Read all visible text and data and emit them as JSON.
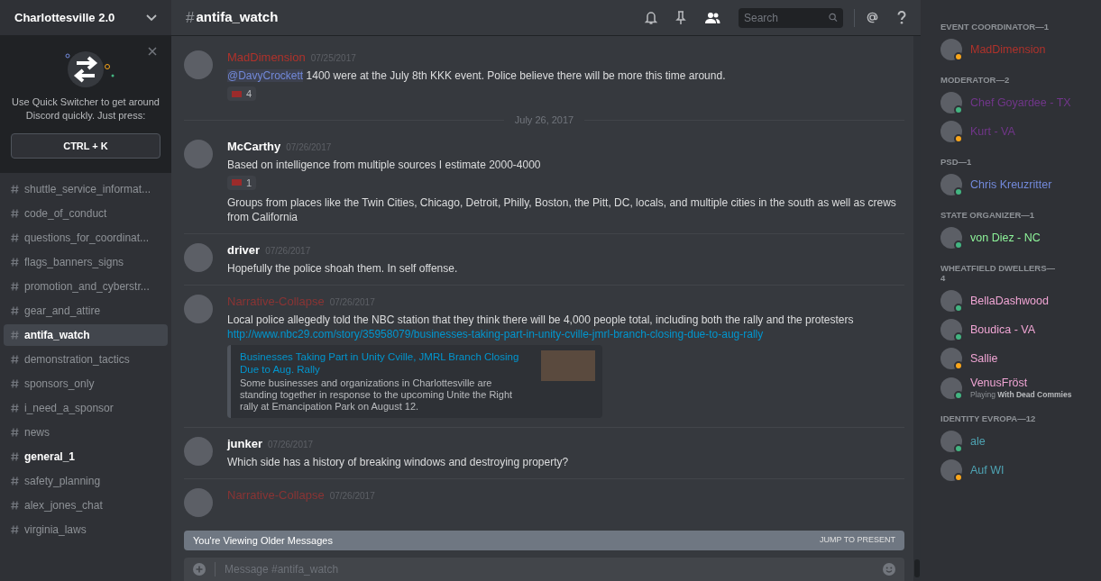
{
  "server": {
    "name": "Charlottesville 2.0"
  },
  "quick_switcher": {
    "text": "Use Quick Switcher to get around Discord quickly. Just press:",
    "shortcut": "CTRL + K"
  },
  "channels": [
    {
      "name": "shuttle_service_informat...",
      "selected": false,
      "unread": false
    },
    {
      "name": "code_of_conduct",
      "selected": false,
      "unread": false
    },
    {
      "name": "questions_for_coordinat...",
      "selected": false,
      "unread": false
    },
    {
      "name": "flags_banners_signs",
      "selected": false,
      "unread": false
    },
    {
      "name": "promotion_and_cyberstr...",
      "selected": false,
      "unread": false
    },
    {
      "name": "gear_and_attire",
      "selected": false,
      "unread": false
    },
    {
      "name": "antifa_watch",
      "selected": true,
      "unread": true
    },
    {
      "name": "demonstration_tactics",
      "selected": false,
      "unread": false
    },
    {
      "name": "sponsors_only",
      "selected": false,
      "unread": false
    },
    {
      "name": "i_need_a_sponsor",
      "selected": false,
      "unread": false
    },
    {
      "name": "news",
      "selected": false,
      "unread": false
    },
    {
      "name": "general_1",
      "selected": false,
      "unread": true
    },
    {
      "name": "safety_planning",
      "selected": false,
      "unread": false
    },
    {
      "name": "alex_jones_chat",
      "selected": false,
      "unread": false
    },
    {
      "name": "virginia_laws",
      "selected": false,
      "unread": false
    }
  ],
  "header": {
    "hash": "#",
    "channel": "antifa_watch",
    "search_placeholder": "Search"
  },
  "messages": [
    {
      "kind": "message",
      "author": "MadDimension",
      "color": "#b0322b",
      "time": "07/25/2017",
      "lines": [
        {
          "mention": "@DavyCrockett",
          "text": "1400 were at the July 8th KKK event. Police believe there will be more this time around."
        }
      ],
      "reactions": [
        {
          "count": "4"
        }
      ]
    },
    {
      "kind": "divider",
      "label": "July 26, 2017"
    },
    {
      "kind": "message",
      "author": "McCarthy",
      "color": "#ffffff",
      "time": "07/26/2017",
      "lines": [
        {
          "text": "Based on intelligence from multiple sources I estimate 2000-4000"
        }
      ],
      "reactions": [
        {
          "count": "1"
        }
      ],
      "extra": "Groups from places like the Twin Cities, Chicago, Detroit, Philly, Boston, the Pitt, DC, locals, and multiple cities in the south as well as crews from California"
    },
    {
      "kind": "message",
      "author": "driver",
      "color": "#ffffff",
      "time": "07/26/2017",
      "lines": [
        {
          "text": "Hopefully the police shoah them. In self offense."
        }
      ]
    },
    {
      "kind": "message",
      "author": "Narrative-Collapse",
      "color": "#8a3434",
      "time": "07/26/2017",
      "lines": [
        {
          "text": "Local police allegedly told the NBC station that they think there will be 4,000 people total, including both the rally and the protesters"
        }
      ],
      "link": "http://www.nbc29.com/story/35958079/businesses-taking-part-in-unity-cville-jmrl-branch-closing-due-to-aug-rally",
      "embed": {
        "title": "Businesses Taking Part in Unity Cville, JMRL Branch Closing Due to Aug. Rally",
        "description": "Some businesses and organizations in Charlottesville are standing together in response to the upcoming Unite the Right rally at Emancipation Park on August 12."
      }
    },
    {
      "kind": "message",
      "author": "junker",
      "color": "#ffffff",
      "time": "07/26/2017",
      "lines": [
        {
          "text": "Which side has a history of breaking windows and destroying property?"
        }
      ]
    },
    {
      "kind": "message",
      "author": "Narrative-Collapse",
      "color": "#8a3434",
      "time": "07/26/2017"
    }
  ],
  "older_bar": {
    "text": "You're Viewing Older Messages",
    "action": "JUMP TO PRESENT"
  },
  "composer": {
    "placeholder": "Message #antifa_watch"
  },
  "member_groups": [
    {
      "title": "EVENT COORDINATOR—1",
      "members": [
        {
          "name": "MadDimension",
          "color": "#b0322b",
          "online": false
        }
      ]
    },
    {
      "title": "MODERATOR—2",
      "members": [
        {
          "name": "Chef Goyardee - TX",
          "color": "#71368a",
          "online": true
        },
        {
          "name": "Kurt - VA",
          "color": "#71368a",
          "online": false
        }
      ]
    },
    {
      "title": "PSD—1",
      "members": [
        {
          "name": "Chris Kreuzritter",
          "color": "#7289da",
          "online": true
        }
      ]
    },
    {
      "title": "STATE ORGANIZER—1",
      "members": [
        {
          "name": "von Diez - NC",
          "color": "#8ef49a",
          "online": true
        }
      ]
    },
    {
      "title": "WHEATFIELD DWELLERS—4",
      "members": [
        {
          "name": "BellaDashwood",
          "color": "#f0a5d4",
          "online": true
        },
        {
          "name": "Boudica - VA",
          "color": "#f0a5d4",
          "online": true
        },
        {
          "name": "Sallie",
          "color": "#f0a5d4",
          "online": false
        },
        {
          "name": "VenusFröst",
          "color": "#f0a5d4",
          "online": true,
          "activity": "Playing",
          "game": "With Dead Commies"
        }
      ]
    },
    {
      "title": "IDENTITY EVROPA—12",
      "members": [
        {
          "name": "ale",
          "color": "#4fa4b4",
          "online": true
        },
        {
          "name": "Auf WI",
          "color": "#4fa4b4",
          "online": false
        }
      ]
    }
  ]
}
